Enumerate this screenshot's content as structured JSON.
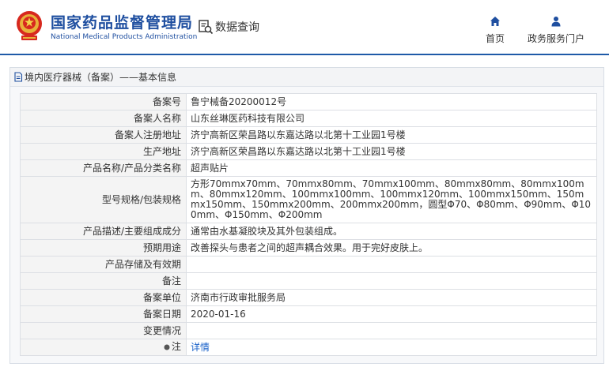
{
  "header": {
    "brand_cn": "国家药品监督管理局",
    "brand_en": "National Medical Products Administration",
    "query_label": "数据查询",
    "nav": [
      {
        "label": "首页",
        "icon": "home-icon"
      },
      {
        "label": "政务服务门户",
        "icon": "user-icon"
      }
    ]
  },
  "panel": {
    "breadcrumb": "境内医疗器械（备案）——基本信息"
  },
  "rows": [
    {
      "label": "备案号",
      "value": "鲁宁械备20200012号"
    },
    {
      "label": "备案人名称",
      "value": "山东丝琳医药科技有限公司"
    },
    {
      "label": "备案人注册地址",
      "value": "济宁高新区荣昌路以东嘉达路以北第十工业园1号楼"
    },
    {
      "label": "生产地址",
      "value": "济宁高新区荣昌路以东嘉达路以北第十工业园1号楼"
    },
    {
      "label": "产品名称/产品分类名称",
      "value": "超声贴片"
    },
    {
      "label": "型号规格/包装规格",
      "value": "方形70mmx70mm、70mmx80mm、70mmx100mm、80mmx80mm、80mmx100mm、80mmx120mm、100mmx100mm、100mmx120mm、100mmx150mm、150mmx150mm、150mmx200mm、200mmx200mm，圆型Φ70、Φ80mm、Φ90mm、Φ100mm、Φ150mm、Φ200mm"
    },
    {
      "label": "产品描述/主要组成成分",
      "value": "通常由水基凝胶块及其外包装组成。"
    },
    {
      "label": "预期用途",
      "value": "改善探头与患者之间的超声耦合效果。用于完好皮肤上。"
    },
    {
      "label": "产品存储及有效期",
      "value": ""
    },
    {
      "label": "备注",
      "value": ""
    },
    {
      "label": "备案单位",
      "value": "济南市行政审批服务局"
    },
    {
      "label": "备案日期",
      "value": "2020-01-16"
    },
    {
      "label": "变更情况",
      "value": ""
    },
    {
      "label": "注",
      "value": "详情"
    }
  ],
  "colors": {
    "brand": "#1f4fa0",
    "link": "#1a62c9",
    "header_border": "#1e5aa8"
  }
}
